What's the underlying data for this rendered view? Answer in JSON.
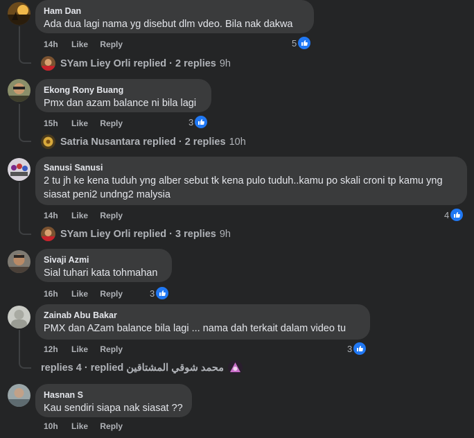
{
  "comments": [
    {
      "author": "Ham Dan",
      "text": "Ada dua lagi nama yg disebut dlm vdeo. Bila nak dakwa",
      "time": "14h",
      "like": "Like",
      "reply": "Reply",
      "reactions": "5",
      "replied": {
        "name": "SYam Liey Orli replied",
        "count": "· 2 replies",
        "time": "9h"
      }
    },
    {
      "author": "Ekong Rony Buang",
      "text": "Pmx dan azam balance ni bila lagi",
      "time": "15h",
      "like": "Like",
      "reply": "Reply",
      "reactions": "3",
      "replied": {
        "name": "Satria Nusantara replied",
        "count": "· 2 replies",
        "time": "10h"
      }
    },
    {
      "author": "Sanusi Sanusi",
      "text": "2 tu jh ke kena tuduh yng alber sebut tk kena pulo tuduh..kamu po skali croni tp kamu yng siasat peni2 undng2 malysia",
      "time": "14h",
      "like": "Like",
      "reply": "Reply",
      "reactions": "4",
      "replied": {
        "name": "SYam Liey Orli replied",
        "count": "· 3 replies",
        "time": "9h"
      }
    },
    {
      "author": "Sivaji Azmi",
      "text": "Sial tuhari kata tohmahan",
      "time": "16h",
      "like": "Like",
      "reply": "Reply",
      "reactions": "3"
    },
    {
      "author": "Zainab Abu Bakar",
      "text": "PMX dan AZam balance bila lagi ... nama dah terkait dalam video tu",
      "time": "12h",
      "like": "Like",
      "reply": "Reply",
      "reactions": "3",
      "replied": {
        "name": "محمد شوقي المشتاقين",
        "count": "replies 4 · replied",
        "time": ""
      }
    },
    {
      "author": "Hasnan S",
      "text": "Kau sendiri siapa nak siasat ??",
      "time": "10h",
      "like": "Like",
      "reply": "Reply",
      "reactions": ""
    }
  ],
  "icons": {
    "like": "thumbs-up-icon"
  },
  "colors": {
    "background": "#242526",
    "bubble": "#3a3b3c",
    "like_blue": "#2078f4",
    "secondary_text": "#b0b3b8"
  }
}
